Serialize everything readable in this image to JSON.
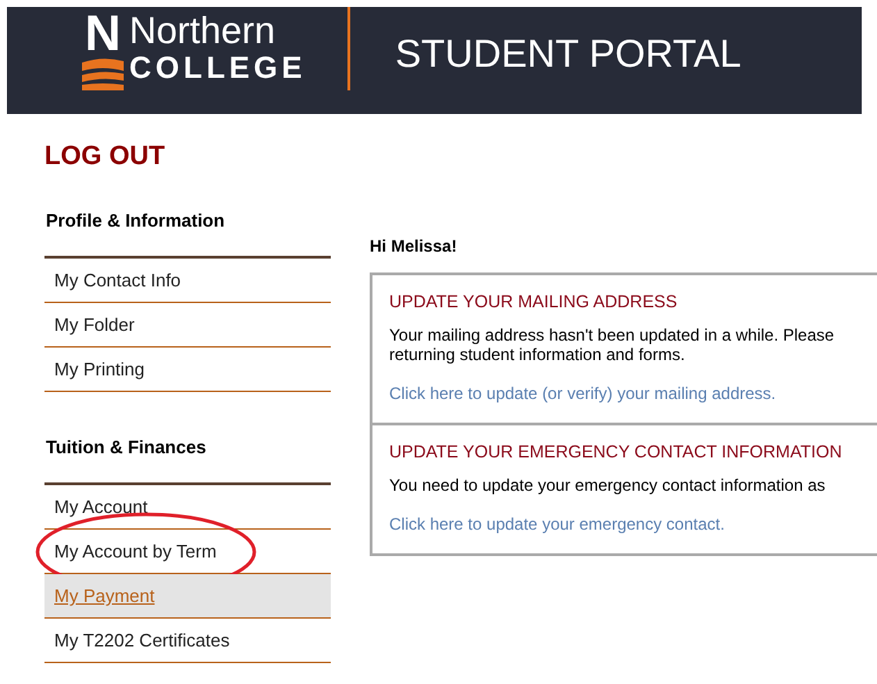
{
  "header": {
    "logo_letter": "N",
    "logo_name": "Northern",
    "logo_sub": "COLLEGE",
    "title": "STUDENT PORTAL"
  },
  "logout": "LOG OUT",
  "sidebar": [
    {
      "heading": "Profile & Information",
      "items": [
        {
          "label": "My Contact Info",
          "selected": false,
          "circled": false
        },
        {
          "label": "My Folder",
          "selected": false,
          "circled": false
        },
        {
          "label": "My Printing",
          "selected": false,
          "circled": false
        }
      ]
    },
    {
      "heading": "Tuition & Finances",
      "items": [
        {
          "label": "My Account",
          "selected": false,
          "circled": false
        },
        {
          "label": "My Account by Term",
          "selected": false,
          "circled": true
        },
        {
          "label": "My Payment",
          "selected": true,
          "circled": false
        },
        {
          "label": "My T2202 Certificates",
          "selected": false,
          "circled": false
        }
      ]
    }
  ],
  "greeting": "Hi Melissa!",
  "notices": [
    {
      "title": "UPDATE YOUR MAILING ADDRESS",
      "lines": [
        "Your mailing address hasn't been updated in a while. Please",
        "returning student information and forms."
      ],
      "link": "Click here to update (or verify) your mailing address."
    },
    {
      "title": "UPDATE YOUR EMERGENCY CONTACT INFORMATION",
      "lines": [
        "You need to update your emergency contact information as"
      ],
      "link": "Click here to update your emergency contact."
    }
  ]
}
